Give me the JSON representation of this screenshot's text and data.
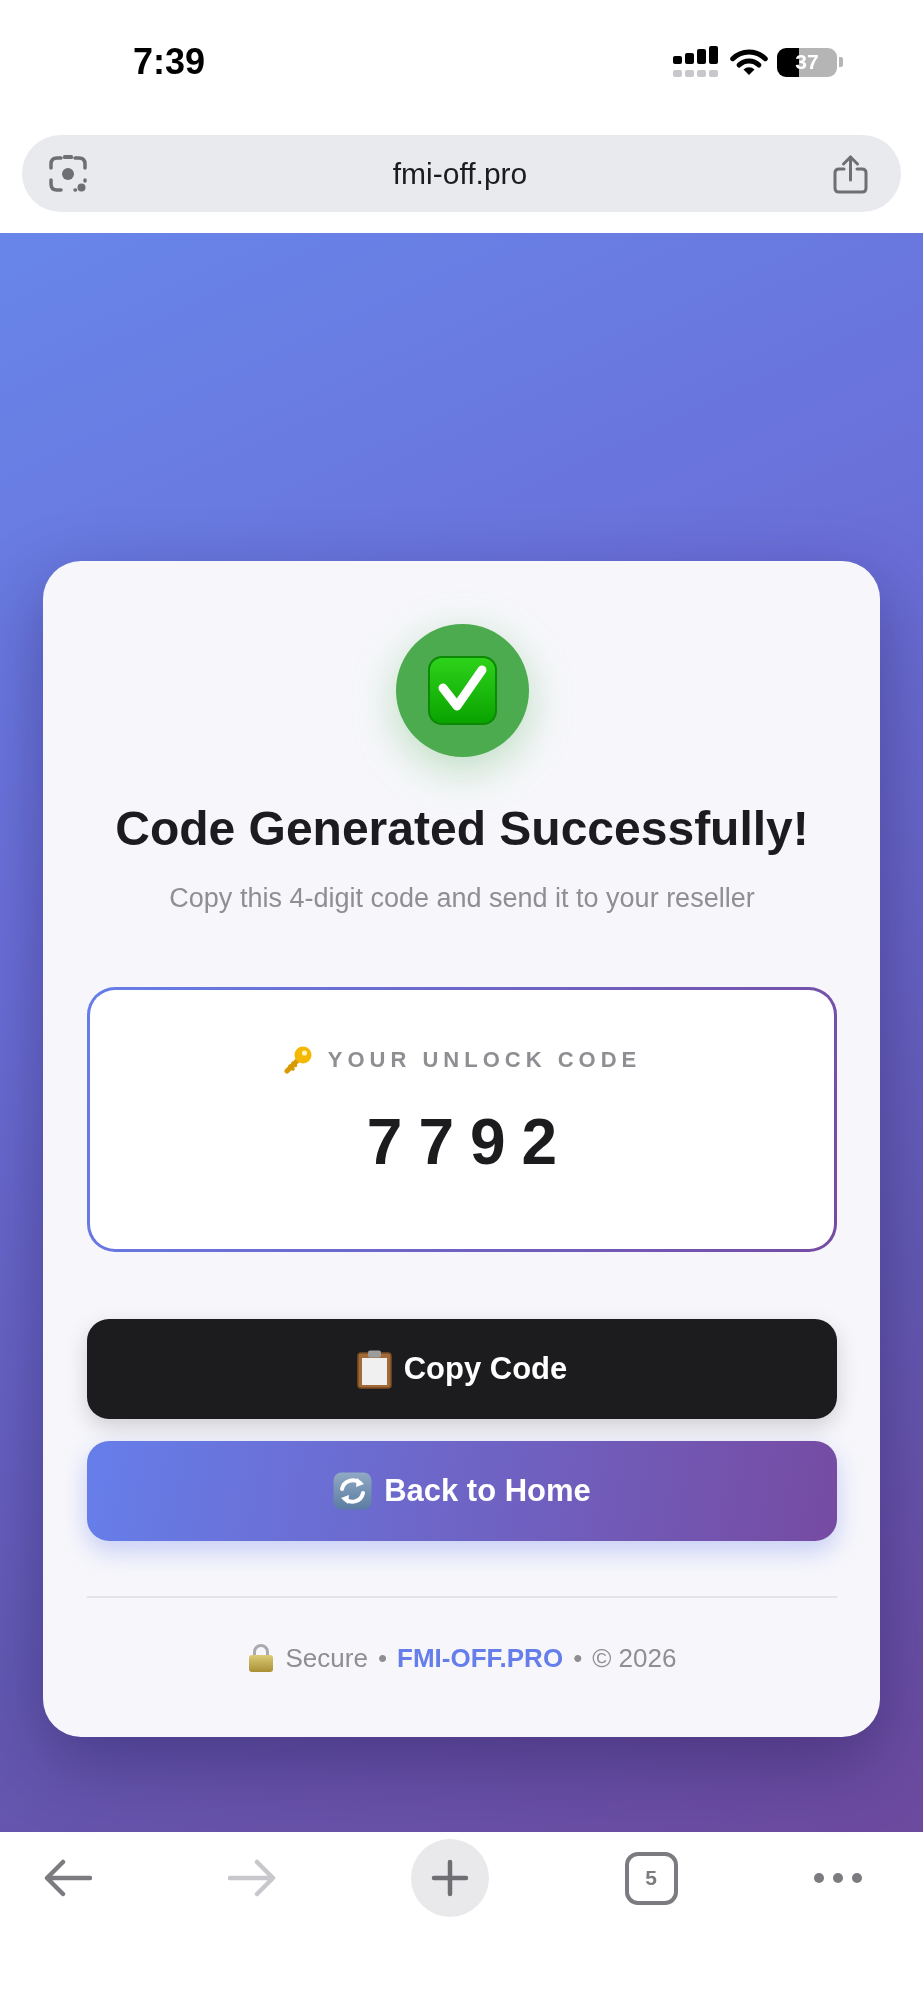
{
  "status_bar": {
    "time": "7:39",
    "battery": "37"
  },
  "address_bar": {
    "url": "fmi-off.pro"
  },
  "card": {
    "title": "Code Generated Successfully!",
    "subtitle": "Copy this 4-digit code and send it to your reseller",
    "code_label": "YOUR UNLOCK CODE",
    "code": "7792",
    "buttons": [
      {
        "kind": "copy",
        "label": "Copy Code"
      },
      {
        "kind": "home",
        "label": "Back to Home"
      }
    ],
    "footer": [
      {
        "kind": "text",
        "text": "Secure"
      },
      {
        "kind": "separator",
        "text": "•"
      },
      {
        "kind": "link",
        "text": "FMI-OFF.PRO"
      },
      {
        "kind": "separator",
        "text": "•"
      },
      {
        "kind": "text",
        "text": "© 2026"
      }
    ]
  },
  "toolbar": {
    "back_disabled": false,
    "forward_disabled": true,
    "tab_count": "5"
  }
}
